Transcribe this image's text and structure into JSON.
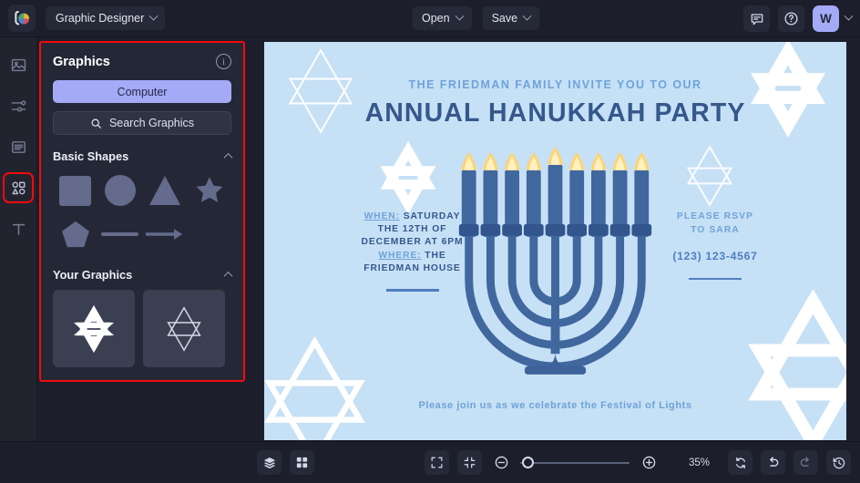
{
  "topbar": {
    "logo_icon": "color-wheel-logo",
    "document_title": "Graphic Designer",
    "open_label": "Open",
    "save_label": "Save",
    "comment_icon": "comment-icon",
    "help_icon": "help-circle-icon",
    "avatar_initial": "W"
  },
  "rail": {
    "items": [
      {
        "icon": "image-icon",
        "name": "image"
      },
      {
        "icon": "adjustments-icon",
        "name": "adjust"
      },
      {
        "icon": "layers-panel-icon",
        "name": "pages"
      },
      {
        "icon": "shapes-icon",
        "name": "graphics"
      },
      {
        "icon": "text-icon",
        "name": "text"
      }
    ],
    "selected_index": 3
  },
  "panel": {
    "title": "Graphics",
    "info_icon": "info-icon",
    "computer_label": "Computer",
    "search_icon": "search-icon",
    "search_label": "Search Graphics",
    "sections": [
      {
        "title": "Basic Shapes",
        "collapse_icon": "chevron-up-icon",
        "shapes": [
          {
            "name": "square-shape"
          },
          {
            "name": "circle-shape"
          },
          {
            "name": "triangle-shape"
          },
          {
            "name": "star-shape"
          },
          {
            "name": "pentagon-shape"
          },
          {
            "name": "line-shape"
          },
          {
            "name": "arrow-shape"
          }
        ]
      },
      {
        "title": "Your Graphics",
        "collapse_icon": "chevron-up-icon",
        "thumbs": [
          {
            "name": "star-of-david-solid"
          },
          {
            "name": "star-of-david-outline"
          }
        ]
      }
    ]
  },
  "canvas": {
    "background_color": "#c6e0f5",
    "accent_dark": "#35588c",
    "accent_light": "#6fa3d8",
    "eyebrow": "THE FRIEDMAN FAMILY INVITE YOU TO OUR",
    "title": "ANNUAL HANUKKAH PARTY",
    "when_label": "WHEN:",
    "when_text": " SATURDAY",
    "when_line2": "THE 12TH OF",
    "when_line3": "DECEMBER AT 6PM",
    "where_label": "WHERE:",
    "where_text": " THE",
    "where_line2": "FRIEDMAN HOUSE",
    "rsvp_line1": "PLEASE RSVP",
    "rsvp_line2": "TO SARA",
    "phone": "(123) 123-4567",
    "footer": "Please join us as we celebrate the Festival of Lights",
    "menorah_icon": "menorah-graphic",
    "decorations": [
      "star-of-david-outline-top-left",
      "star-of-david-solid-top-right",
      "star-of-david-solid-mid-left",
      "star-of-david-outline-mid-right",
      "star-of-david-outline-bottom-left",
      "star-of-david-outline-bottom-right"
    ]
  },
  "bottombar": {
    "layers_icon": "layers-icon",
    "grid_icon": "grid-icon",
    "fullscreen_icon": "fullscreen-icon",
    "fit_icon": "fit-to-screen-icon",
    "zoom_out_icon": "zoom-out-icon",
    "zoom_in_icon": "zoom-in-icon",
    "zoom_value": "35%",
    "zoom_slider_percent": 2,
    "reset_icon": "reset-icon",
    "undo_icon": "undo-icon",
    "redo_icon": "redo-icon",
    "history_icon": "history-icon"
  }
}
